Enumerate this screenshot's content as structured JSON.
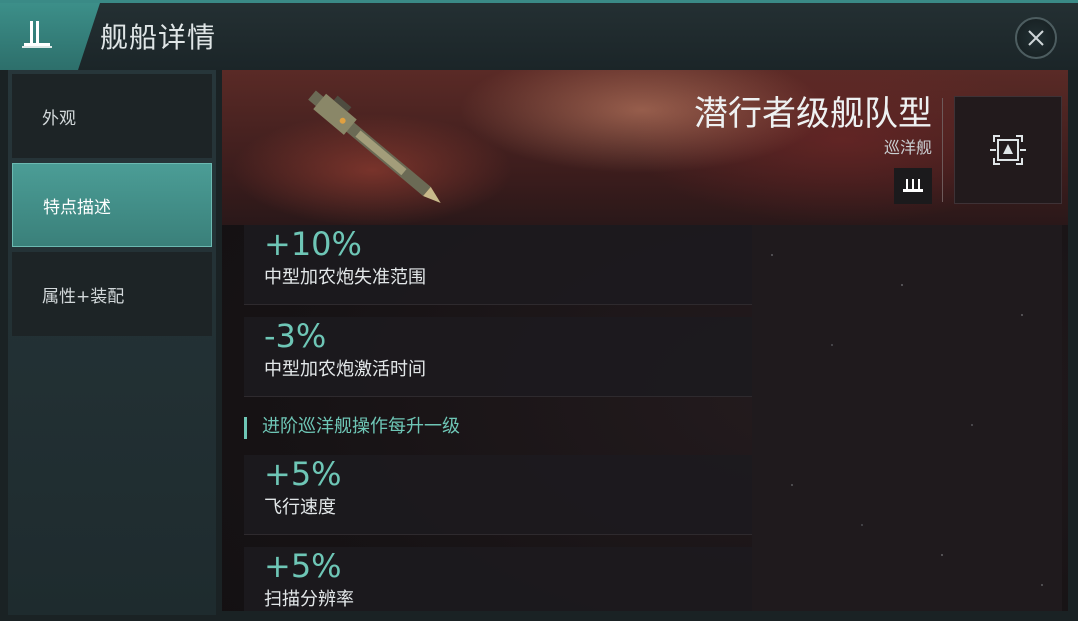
{
  "header": {
    "title": "舰船详情",
    "icon": "fleet-icon",
    "close_icon": "close-icon"
  },
  "sidebar": {
    "items": [
      {
        "label": "外观",
        "active": false
      },
      {
        "label": "特点描述",
        "active": true
      },
      {
        "label": "属性+装配",
        "active": false
      }
    ]
  },
  "ship": {
    "name": "潜行者级舰队型",
    "class": "巡洋舰",
    "class_icon": "cruiser-class-icon",
    "thumb_icon": "ship-target-icon"
  },
  "bonuses": [
    {
      "value": "+10%",
      "label": "中型加农炮失准范围"
    },
    {
      "value": "-3%",
      "label": "中型加农炮激活时间"
    }
  ],
  "section": {
    "label": "进阶巡洋舰操作每升一级"
  },
  "section_bonuses": [
    {
      "value": "+5%",
      "label": "飞行速度"
    },
    {
      "value": "+5%",
      "label": "扫描分辨率"
    }
  ],
  "colors": {
    "accent": "#6ec6b6",
    "active_tab": "#4b9d96"
  }
}
